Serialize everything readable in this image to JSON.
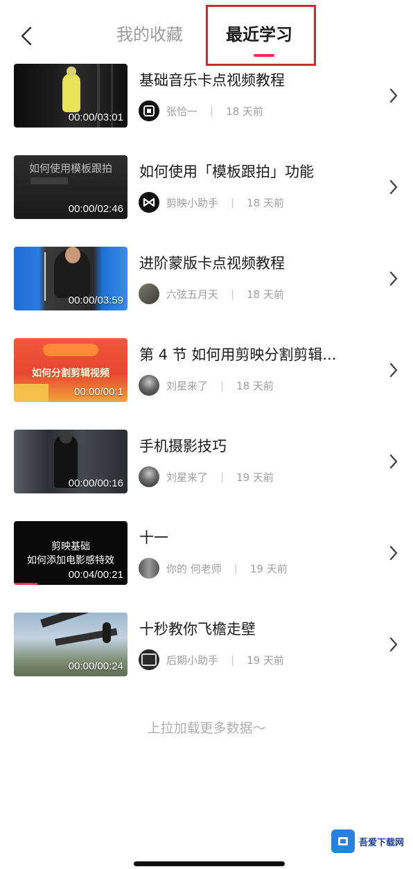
{
  "header": {
    "tabs": [
      {
        "label": "我的收藏",
        "active": false
      },
      {
        "label": "最近学习",
        "active": true
      }
    ],
    "accent_color": "#ff2b55"
  },
  "items": [
    {
      "title": "基础音乐卡点视频教程",
      "author": "张恰一",
      "time": "18 天前",
      "duration": "00:00/03:01",
      "thumb_caption": []
    },
    {
      "title": "如何使用「模板跟拍」功能",
      "author": "剪映小助手",
      "time": "18 天前",
      "duration": "00:00/02:46",
      "thumb_caption": [
        "如何使用模板跟拍"
      ]
    },
    {
      "title": "进阶蒙版卡点视频教程",
      "author": "六弦五月天",
      "time": "18 天前",
      "duration": "00:00/03:59",
      "thumb_caption": []
    },
    {
      "title": "第 4 节 如何用剪映分割剪辑...",
      "author": "刘星来了",
      "time": "18 天前",
      "duration": "00:00/00:1",
      "thumb_caption": [
        "如何分割剪辑视频"
      ]
    },
    {
      "title": "手机摄影技巧",
      "author": "刘星来了",
      "time": "19 天前",
      "duration": "00:00/00:16",
      "thumb_caption": []
    },
    {
      "title": "十一",
      "author": "你的 何老师",
      "time": "19 天前",
      "duration": "00:04/00:21",
      "thumb_caption": [
        "剪映基础",
        "如何添加电影感特效"
      ]
    },
    {
      "title": "十秒教你飞檐走壁",
      "author": "后期小助手",
      "time": "19 天前",
      "duration": "00:00/00:24",
      "thumb_caption": []
    }
  ],
  "footer": {
    "load_more": "上拉加载更多数据～"
  },
  "watermark": {
    "label": "吾爱下载网"
  }
}
